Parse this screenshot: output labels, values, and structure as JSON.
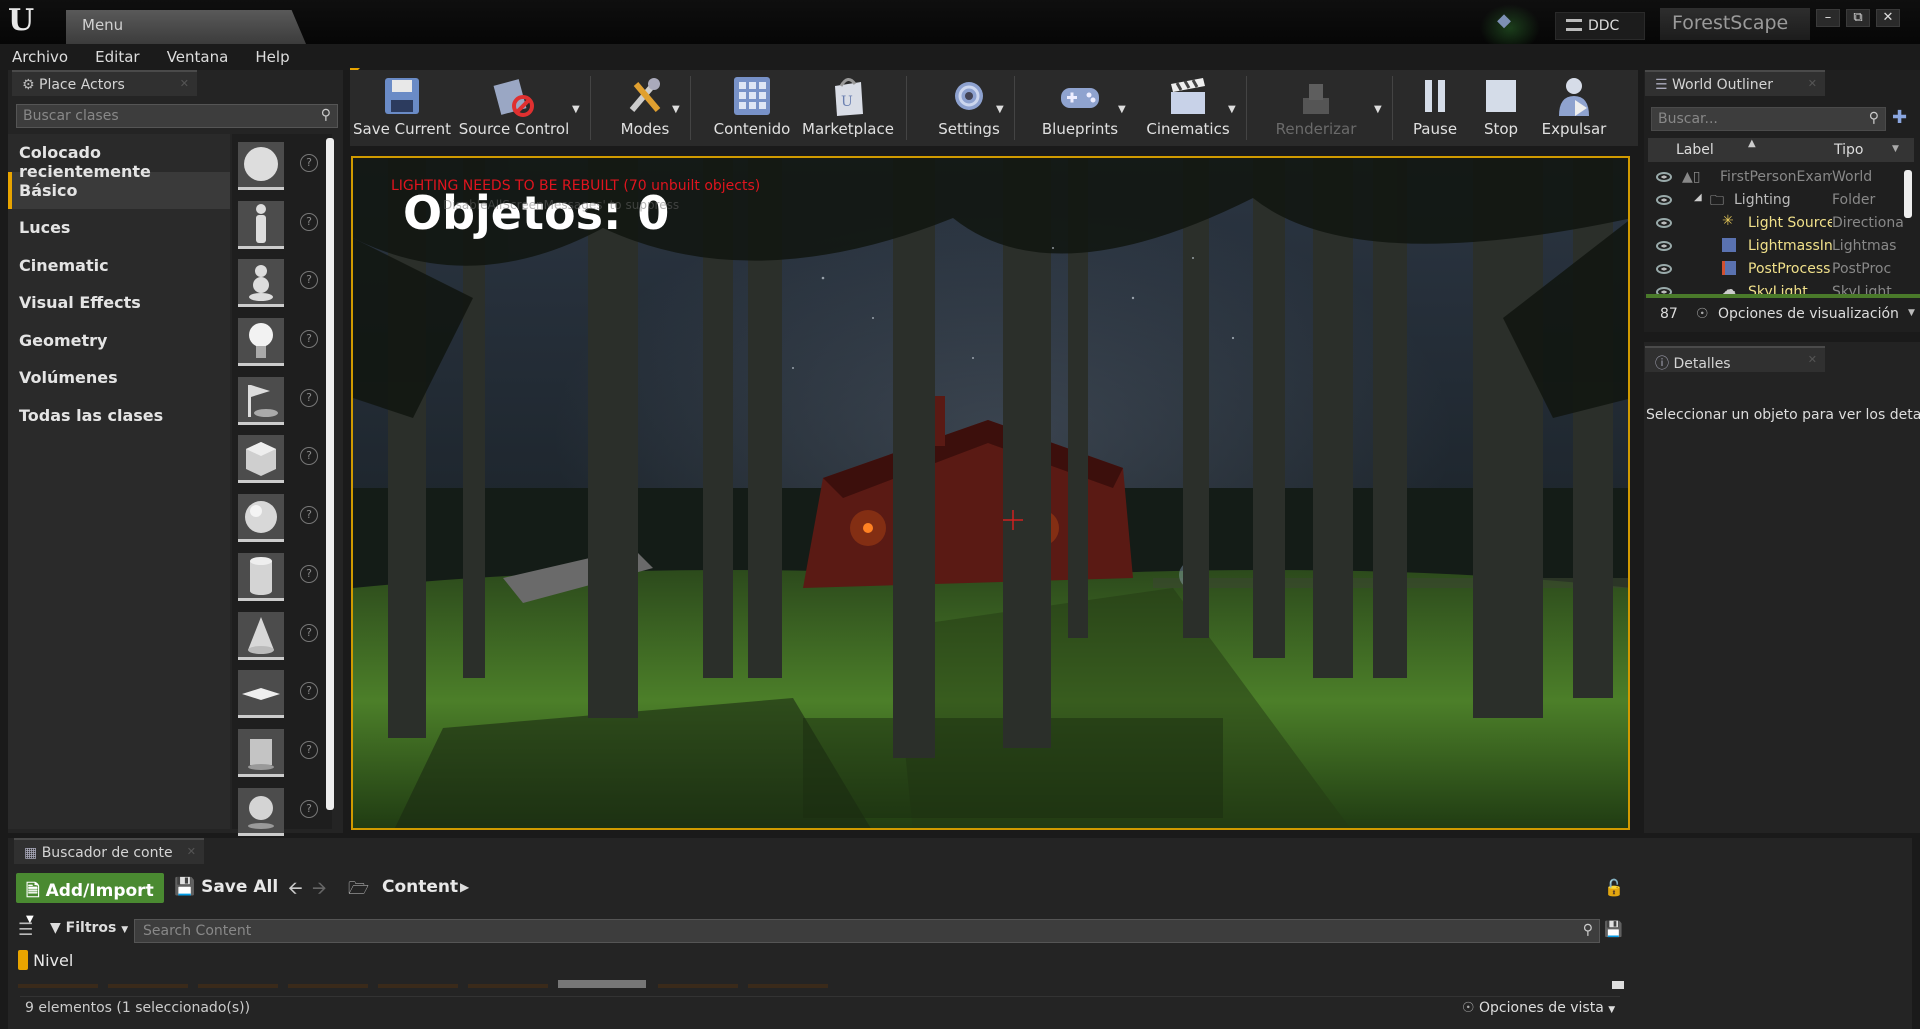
{
  "window": {
    "menu_tab": "Menu",
    "ddc_label": "DDC",
    "project_name": "ForestScape"
  },
  "menubar": [
    "Archivo",
    "Editar",
    "Ventana",
    "Help"
  ],
  "place_actors": {
    "tab_title": "Place Actors",
    "search_placeholder": "Buscar clases",
    "categories": [
      {
        "label": "Colocado recientemente",
        "selected": false
      },
      {
        "label": "Básico",
        "selected": true
      },
      {
        "label": "Luces",
        "selected": false
      },
      {
        "label": "Cinematic",
        "selected": false
      },
      {
        "label": "Visual Effects",
        "selected": false
      },
      {
        "label": "Geometry",
        "selected": false
      },
      {
        "label": "Volúmenes",
        "selected": false
      },
      {
        "label": "Todas las clases",
        "selected": false
      }
    ],
    "items": [
      {
        "icon": "empty-actor-sphere-icon"
      },
      {
        "icon": "character-figure-icon"
      },
      {
        "icon": "pawn-figure-icon"
      },
      {
        "icon": "point-light-bulb-icon"
      },
      {
        "icon": "player-start-flag-icon"
      },
      {
        "icon": "cube-icon"
      },
      {
        "icon": "sphere-icon"
      },
      {
        "icon": "cylinder-icon"
      },
      {
        "icon": "cone-icon"
      },
      {
        "icon": "plane-icon"
      },
      {
        "icon": "box-trigger-icon"
      },
      {
        "icon": "sphere-trigger-icon"
      }
    ]
  },
  "toolbar": {
    "buttons": [
      {
        "label": "Save Current",
        "icon": "floppy-disk-icon",
        "has_dropdown": false,
        "enabled": true
      },
      {
        "label": "Source Control",
        "icon": "source-control-icon",
        "has_dropdown": true,
        "enabled": true
      },
      {
        "label": "Modes",
        "icon": "modes-tools-icon",
        "has_dropdown": true,
        "enabled": true
      },
      {
        "label": "Contenido",
        "icon": "content-grid-icon",
        "has_dropdown": false,
        "enabled": true
      },
      {
        "label": "Marketplace",
        "icon": "marketplace-bag-icon",
        "has_dropdown": false,
        "enabled": true
      },
      {
        "label": "Settings",
        "icon": "settings-gear-icon",
        "has_dropdown": true,
        "enabled": true
      },
      {
        "label": "Blueprints",
        "icon": "blueprints-gamepad-icon",
        "has_dropdown": true,
        "enabled": true
      },
      {
        "label": "Cinematics",
        "icon": "cinematics-clapper-icon",
        "has_dropdown": true,
        "enabled": true
      },
      {
        "label": "Renderizar",
        "icon": "build-blocks-icon",
        "has_dropdown": true,
        "enabled": false
      },
      {
        "label": "Pause",
        "icon": "pause-icon",
        "has_dropdown": false,
        "enabled": true
      },
      {
        "label": "Stop",
        "icon": "stop-icon",
        "has_dropdown": false,
        "enabled": true
      },
      {
        "label": "Expulsar",
        "icon": "eject-person-icon",
        "has_dropdown": false,
        "enabled": true
      }
    ]
  },
  "viewport": {
    "hud_text": "Objetos: 0",
    "warning_text": "LIGHTING NEEDS TO BE REBUILT (70 unbuilt objects)",
    "faded_text": "DisableAllScreenMessages' to suppress"
  },
  "world_outliner": {
    "tab_title": "World Outliner",
    "search_placeholder": "Buscar...",
    "col_label": "Label",
    "col_type": "Tipo",
    "rows": [
      {
        "label": "FirstPersonExam",
        "type": "World",
        "indent": 0,
        "style": "dim",
        "icon": "world-icon"
      },
      {
        "label": "Lighting",
        "type": "Folder",
        "indent": 1,
        "style": "normal",
        "icon": "folder-icon"
      },
      {
        "label": "Light Source",
        "type": "Directiona",
        "indent": 2,
        "style": "actor",
        "icon": "directional-light-icon"
      },
      {
        "label": "LightmassIn",
        "type": "Lightmas",
        "indent": 2,
        "style": "actor",
        "icon": "lightmass-volume-icon"
      },
      {
        "label": "PostProcess",
        "type": "PostProc",
        "indent": 2,
        "style": "actor",
        "icon": "postprocess-volume-icon"
      },
      {
        "label": "SkyLight",
        "type": "SkyLight",
        "indent": 2,
        "style": "actor",
        "icon": "skylight-icon"
      }
    ],
    "count": "87",
    "view_options": "Opciones de visualización"
  },
  "details": {
    "tab_title": "Detalles",
    "message": "Seleccionar un objeto para ver los detall"
  },
  "content_browser": {
    "tab_title": "Buscador de conte",
    "add_import": "Add/Import",
    "save_all": "Save All",
    "path": "Content",
    "filters": "Filtros",
    "search_placeholder": "Search Content",
    "filter_chip": "Nivel",
    "status": "9 elementos (1 seleccionado(s))",
    "view_options": "Opciones de vista"
  },
  "colors": {
    "accent_orange": "#e8a400",
    "green_button": "#4a8a31",
    "warning_red": "#e0141e",
    "viewport_border": "#d09a00"
  }
}
